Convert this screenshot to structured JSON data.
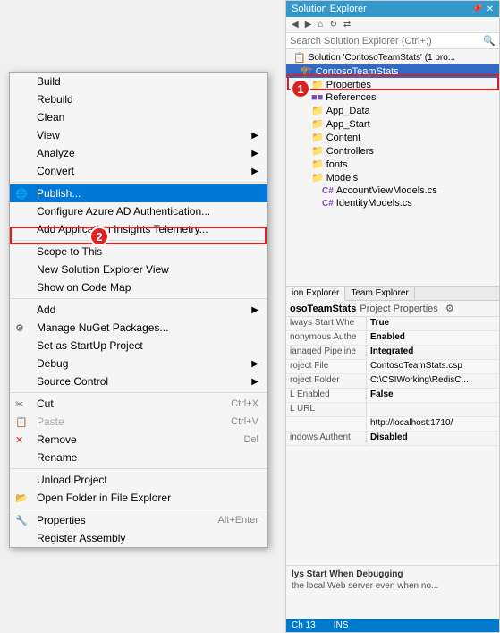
{
  "solution_explorer": {
    "title": "Solution Explorer",
    "search_placeholder": "Search Solution Explorer (Ctrl+;)",
    "tree": {
      "root": "Solution 'ContosoTeamStats'",
      "project": "ContosoTeamStats",
      "items": [
        {
          "label": "Properties",
          "type": "folder",
          "depth": 1
        },
        {
          "label": "References",
          "type": "ref",
          "depth": 1
        },
        {
          "label": "App_Data",
          "type": "folder",
          "depth": 1
        },
        {
          "label": "App_Start",
          "type": "folder",
          "depth": 1
        },
        {
          "label": "Content",
          "type": "folder",
          "depth": 1
        },
        {
          "label": "Controllers",
          "type": "folder",
          "depth": 1
        },
        {
          "label": "fonts",
          "type": "folder",
          "depth": 1
        },
        {
          "label": "Models",
          "type": "folder",
          "depth": 1
        },
        {
          "label": "AccountViewModels.cs",
          "type": "cs",
          "depth": 2
        },
        {
          "label": "IdentityModels.cs",
          "type": "cs",
          "depth": 2
        }
      ]
    }
  },
  "properties_panel": {
    "tabs": [
      "ion Explorer",
      "Team Explorer"
    ],
    "project_name": "osoTeamStats",
    "link": "Project Properties",
    "rows": [
      {
        "key": "lways Start Whe",
        "val": "True",
        "bold": true
      },
      {
        "key": "nonymous Authe",
        "val": "Enabled",
        "bold": true
      },
      {
        "key": "ianaged Pipeline",
        "val": "Integrated",
        "bold": true
      },
      {
        "key": "roject File",
        "val": "ContosoTeamStats.csp",
        "bold": false
      },
      {
        "key": "roject Folder",
        "val": "C:\\CSIWorking\\RedisC...",
        "bold": false
      },
      {
        "key": "L Enabled",
        "val": "False",
        "bold": true
      },
      {
        "key": "L URL",
        "val": "",
        "bold": false
      },
      {
        "key": "",
        "val": "http://localhost:1710/",
        "bold": false
      },
      {
        "key": "indows Authent",
        "val": "Disabled",
        "bold": true
      }
    ],
    "description": "lys Start When Debugging\nthe local Web server even when no...",
    "statusbar": {
      "col": "Ch 13",
      "mode": "INS"
    }
  },
  "context_menu": {
    "items": [
      {
        "label": "Build",
        "type": "item",
        "icon": ""
      },
      {
        "label": "Rebuild",
        "type": "item",
        "icon": ""
      },
      {
        "label": "Clean",
        "type": "item",
        "icon": ""
      },
      {
        "label": "View",
        "type": "submenu",
        "icon": ""
      },
      {
        "label": "Analyze",
        "type": "submenu",
        "icon": ""
      },
      {
        "label": "Convert",
        "type": "submenu",
        "icon": ""
      },
      {
        "label": "separator1",
        "type": "separator"
      },
      {
        "label": "Publish...",
        "type": "item",
        "icon": "publish",
        "highlighted": true
      },
      {
        "label": "Configure Azure AD Authentication...",
        "type": "item",
        "icon": ""
      },
      {
        "label": "Add Application Insights Telemetry...",
        "type": "item",
        "icon": ""
      },
      {
        "label": "separator2",
        "type": "separator"
      },
      {
        "label": "Scope to This",
        "type": "item",
        "icon": ""
      },
      {
        "label": "New Solution Explorer View",
        "type": "item",
        "icon": ""
      },
      {
        "label": "Show on Code Map",
        "type": "item",
        "icon": ""
      },
      {
        "label": "separator3",
        "type": "separator"
      },
      {
        "label": "Add",
        "type": "submenu",
        "icon": ""
      },
      {
        "label": "Manage NuGet Packages...",
        "type": "item",
        "icon": "nuget"
      },
      {
        "label": "Set as StartUp Project",
        "type": "item",
        "icon": ""
      },
      {
        "label": "Debug",
        "type": "submenu",
        "icon": ""
      },
      {
        "label": "Source Control",
        "type": "submenu",
        "icon": ""
      },
      {
        "label": "separator4",
        "type": "separator"
      },
      {
        "label": "Cut",
        "type": "item",
        "icon": "cut",
        "shortcut": "Ctrl+X"
      },
      {
        "label": "Paste",
        "type": "item",
        "icon": "paste",
        "shortcut": "Ctrl+V",
        "disabled": true
      },
      {
        "label": "Remove",
        "type": "item",
        "icon": "remove",
        "shortcut": "Del"
      },
      {
        "label": "Rename",
        "type": "item",
        "icon": ""
      },
      {
        "label": "separator5",
        "type": "separator"
      },
      {
        "label": "Unload Project",
        "type": "item",
        "icon": ""
      },
      {
        "label": "Open Folder in File Explorer",
        "type": "item",
        "icon": "folder"
      },
      {
        "label": "separator6",
        "type": "separator"
      },
      {
        "label": "Properties",
        "type": "item",
        "icon": "properties",
        "shortcut": "Alt+Enter"
      },
      {
        "label": "Register Assembly",
        "type": "item",
        "icon": ""
      }
    ]
  },
  "badges": {
    "badge1": "1",
    "badge2": "2"
  }
}
